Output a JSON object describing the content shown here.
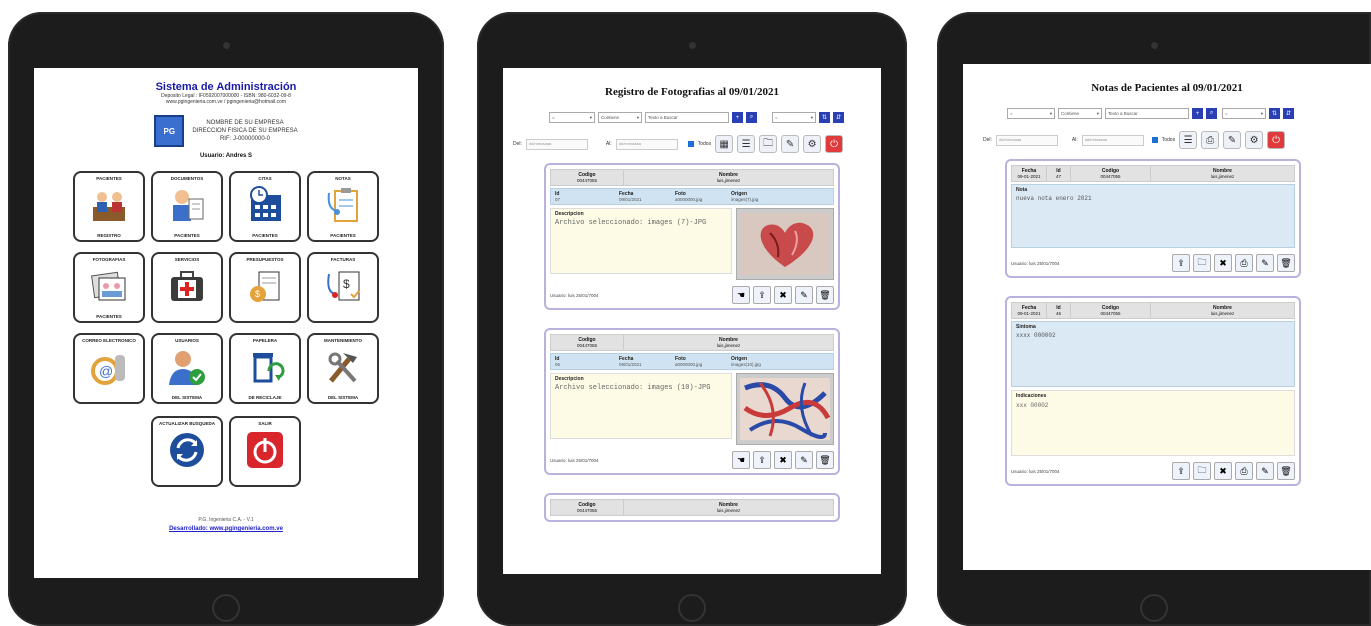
{
  "menu": {
    "title": "Sistema de Administración",
    "sub1": "Deposito Legal : IF0592007000000 - ISBN: 980-6032-09-8",
    "sub2": "www.pgingenieria.com.ve / pgingenieria@hotmail.com",
    "company1": "NOMBRE DE SU EMPRESA",
    "company2": "DIRECCION FISICA DE SU EMPRESA",
    "company3": "RIF: J-00000000-0",
    "user": "Usuario: Andres S",
    "tiles": [
      {
        "top": "PACIENTES",
        "bottom": "REGISTRO"
      },
      {
        "top": "DOCUMENTOS",
        "bottom": "PACIENTES"
      },
      {
        "top": "CITAS",
        "bottom": "PACIENTES"
      },
      {
        "top": "NOTAS",
        "bottom": "PACIENTES"
      },
      {
        "top": "FOTOGRAFIAS",
        "bottom": "PACIENTES"
      },
      {
        "top": "SERVICIOS",
        "bottom": ""
      },
      {
        "top": "PRESUPUESTOS",
        "bottom": ""
      },
      {
        "top": "FACTURAS",
        "bottom": ""
      },
      {
        "top": "CORREO ELECTRONICO",
        "bottom": ""
      },
      {
        "top": "USUARIOS",
        "bottom": "DEL SISTEMA"
      },
      {
        "top": "PAPELERA",
        "bottom": "DE RECICLAJE"
      },
      {
        "top": "MANTENIMIENTO",
        "bottom": "DEL SISTEMA"
      }
    ],
    "bottom_tiles": [
      {
        "top": "ACTUALIZAR BUSQUEDA"
      },
      {
        "top": "SALIR"
      }
    ],
    "footer": "P.G. Ingenieria C.A. - V.1",
    "link": "Desarrollado: www.pgingenieria.com.ve"
  },
  "photos": {
    "title": "Registro de Fotografias al 09/01/2021",
    "select1": "=",
    "select2": "Contiene",
    "search_placeholder": "Texto a Buscar",
    "select3": "=",
    "label_del": "Del:",
    "label_al": "Al:",
    "date_placeholder": "dd/mm/aaaa",
    "todos": "Todos",
    "cards": [
      {
        "codigo_label": "Codigo",
        "codigo": "00447055",
        "nombre_label": "Nombre",
        "nombre": "luis,jimenez",
        "id_label": "Id",
        "id": "07",
        "fecha_label": "Fecha",
        "fecha": "09/01/2021",
        "foto_label": "Foto",
        "foto": "a0000000.jpg",
        "origen_label": "Origen",
        "origen": "images(7).jpg",
        "desc_label": "Descripcion",
        "desc": "Archivo seleccionado: images (7)-JPG",
        "usuario": "Usuario: luis 25/01/7004"
      },
      {
        "codigo_label": "Codigo",
        "codigo": "00447055",
        "nombre_label": "Nombre",
        "nombre": "luis,jimenez",
        "id_label": "Id",
        "id": "06",
        "fecha_label": "Fecha",
        "fecha": "09/01/2021",
        "foto_label": "Foto",
        "foto": "a0000000.jpg",
        "origen_label": "Origen",
        "origen": "images(10).jpg",
        "desc_label": "Descripcion",
        "desc": "Archivo seleccionado: images (10)-JPG",
        "usuario": "Usuario: luis 25/01/7004"
      },
      {
        "codigo_label": "Codigo",
        "codigo": "00447055",
        "nombre_label": "Nombre",
        "nombre": "luis,jimenez"
      }
    ]
  },
  "notes": {
    "title": "Notas de Pacientes al 09/01/2021",
    "select1": "=",
    "select2": "Contiene",
    "search_placeholder": "Texto a Buscar",
    "select3": "=",
    "label_del": "Del:",
    "label_al": "Al:",
    "date_placeholder": "dd/mm/aaaa",
    "todos": "Todos",
    "cards": [
      {
        "fecha_label": "Fecha",
        "fecha": "09-01-2021",
        "id_label": "Id",
        "id": "47",
        "codigo_label": "Codigo",
        "codigo": "00447055",
        "nombre_label": "Nombre",
        "nombre": "luis,jimenez",
        "box1_label": "Nota",
        "box1": "nueva nota enero 2021",
        "usuario": "Usuario: luis 25/01/7004"
      },
      {
        "fecha_label": "Fecha",
        "fecha": "09-01-2021",
        "id_label": "Id",
        "id": "46",
        "codigo_label": "Codigo",
        "codigo": "00447055",
        "nombre_label": "Nombre",
        "nombre": "luis,jimenez",
        "box1_label": "Sintoma",
        "box1": "xxxx 000002",
        "box2_label": "Indicaciones",
        "box2": "xxx 00002",
        "usuario": "Usuario: luis 25/01/7004"
      }
    ]
  },
  "colors": {
    "title_blue": "#1a1aa8",
    "card_border": "#b9b2dc",
    "row_blue": "#cfe3f2",
    "desc_yellow": "#fdfbe6",
    "exit_red": "#d9262c"
  }
}
